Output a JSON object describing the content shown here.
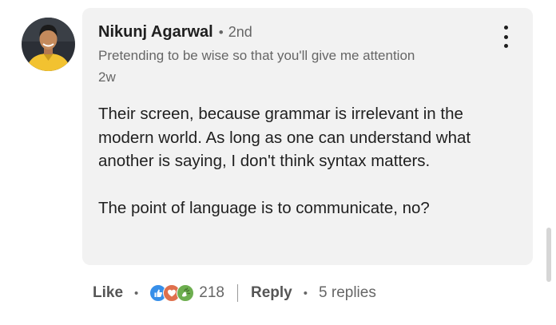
{
  "comment": {
    "author": {
      "name": "Nikunj Agarwal",
      "degree_separator": "•",
      "degree": "2nd",
      "headline": "Pretending to be wise so that you'll give me attention",
      "avatar_icon": "profile-photo"
    },
    "timestamp": "2w",
    "more_icon": "vertical-ellipsis-icon",
    "paragraphs": [
      "Their screen, because grammar is irrelevant in the modern world. As long as one can understand what another is saying, I don't think syntax matters.",
      "The point of language is to communicate, no?"
    ],
    "colors": {
      "bubble_background": "#f2f2f2",
      "like_reaction": "#378fe9",
      "love_reaction": "#df704d",
      "celebrate_reaction": "#44712e"
    }
  },
  "actions": {
    "like_label": "Like",
    "separator": "•",
    "reactions": [
      "like-reaction-icon",
      "love-reaction-icon",
      "celebrate-reaction-icon"
    ],
    "reaction_count": "218",
    "reply_label": "Reply",
    "replies_label": "5 replies"
  }
}
